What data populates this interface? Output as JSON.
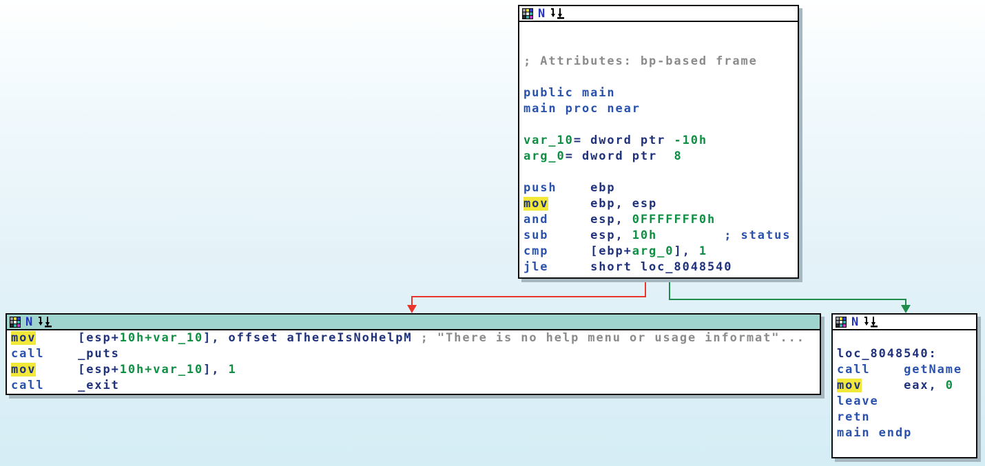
{
  "palette": {
    "edge_red": "#ea352b",
    "edge_green": "#1e8c4b",
    "highlight_yellow": "#f2e839",
    "current_node_header_teal": "#9fd3cd",
    "mnemonic_blue": "#2a52ad",
    "operand_navy": "#20327c",
    "number_green": "#0f8f43",
    "comment_gray": "#8b8b8b"
  },
  "header_icons": {
    "name_label": "N",
    "grid_colors": [
      "#9aa0a6",
      "#e8e23a",
      "#2b3fd0",
      "#8b9196",
      "#ffffff",
      "#35b0a8",
      "#23282d",
      "#3cb0a8",
      "#c23ac2"
    ]
  },
  "blocks": {
    "top": {
      "lines": [
        [],
        [],
        [
          {
            "t": "; Attributes: bp-based frame",
            "c": "gray"
          }
        ],
        [],
        [
          {
            "t": "public main",
            "c": "mn"
          }
        ],
        [
          {
            "t": "main proc near",
            "c": "mn"
          }
        ],
        [],
        [
          {
            "t": "var_10",
            "c": "num"
          },
          {
            "t": "= dword ptr ",
            "c": "op"
          },
          {
            "t": "-10h",
            "c": "num"
          }
        ],
        [
          {
            "t": "arg_0",
            "c": "num"
          },
          {
            "t": "= dword ptr  ",
            "c": "op"
          },
          {
            "t": "8",
            "c": "num"
          }
        ],
        [],
        [
          {
            "t": "push",
            "c": "mn"
          },
          {
            "t": "    ebp",
            "c": "op"
          }
        ],
        [
          {
            "t": "mov",
            "c": "hl"
          },
          {
            "t": "     ebp, esp",
            "c": "op"
          }
        ],
        [
          {
            "t": "and",
            "c": "mn"
          },
          {
            "t": "     esp, ",
            "c": "op"
          },
          {
            "t": "0FFFFFFF0h",
            "c": "num"
          }
        ],
        [
          {
            "t": "sub",
            "c": "mn"
          },
          {
            "t": "     esp, ",
            "c": "op"
          },
          {
            "t": "10h",
            "c": "num"
          },
          {
            "t": "        ",
            "c": "op"
          },
          {
            "t": "; status",
            "c": "mn"
          }
        ],
        [
          {
            "t": "cmp",
            "c": "mn"
          },
          {
            "t": "     [ebp+",
            "c": "op"
          },
          {
            "t": "arg_0",
            "c": "num"
          },
          {
            "t": "], ",
            "c": "op"
          },
          {
            "t": "1",
            "c": "num"
          }
        ],
        [
          {
            "t": "jle",
            "c": "mn"
          },
          {
            "t": "     short loc_8048540",
            "c": "op"
          }
        ]
      ]
    },
    "left": {
      "lines": [
        [
          {
            "t": "mov",
            "c": "hl"
          },
          {
            "t": "     [esp+",
            "c": "op"
          },
          {
            "t": "10h+var_10",
            "c": "num"
          },
          {
            "t": "], offset aThereIsNoHelpM ",
            "c": "op"
          },
          {
            "t": "; \"There is no help menu or usage informat\"...",
            "c": "gray"
          }
        ],
        [
          {
            "t": "call",
            "c": "mn"
          },
          {
            "t": "    _puts",
            "c": "op"
          }
        ],
        [
          {
            "t": "mov",
            "c": "hl"
          },
          {
            "t": "     [esp+",
            "c": "op"
          },
          {
            "t": "10h+var_10",
            "c": "num"
          },
          {
            "t": "], ",
            "c": "op"
          },
          {
            "t": "1",
            "c": "num"
          }
        ],
        [
          {
            "t": "call",
            "c": "mn"
          },
          {
            "t": "    _exit",
            "c": "op"
          }
        ]
      ]
    },
    "right": {
      "lines": [
        [],
        [
          {
            "t": "loc_8048540:",
            "c": "op"
          }
        ],
        [
          {
            "t": "call",
            "c": "mn"
          },
          {
            "t": "    ",
            "c": "op"
          },
          {
            "t": "getName",
            "c": "mn"
          }
        ],
        [
          {
            "t": "mov",
            "c": "hl"
          },
          {
            "t": "     eax, ",
            "c": "op"
          },
          {
            "t": "0",
            "c": "num"
          }
        ],
        [
          {
            "t": "leave",
            "c": "mn"
          }
        ],
        [
          {
            "t": "retn",
            "c": "mn"
          }
        ],
        [
          {
            "t": "main endp",
            "c": "mn"
          }
        ],
        []
      ]
    }
  }
}
